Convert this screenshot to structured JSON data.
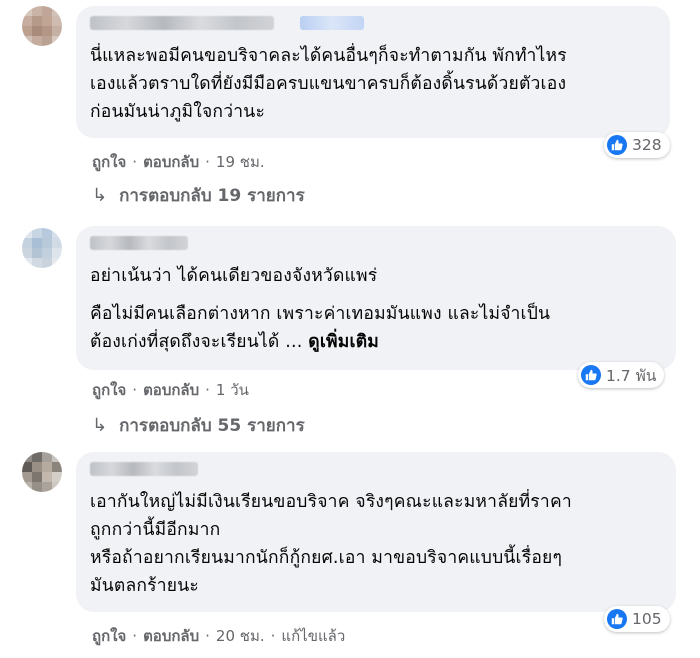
{
  "comments": [
    {
      "text_lines": [
        "นี่แหละพอมีคนขอบริจาคละได้คนอื่นๆก็จะทำตามกัน พักทำไหร",
        "เองแล้วตราบใดที่ยังมีมือครบแขนขาครบก็ต้องดิ้นรนด้วยตัวเอง",
        "ก่อนมันน่าภูมิใจกว่านะ"
      ],
      "reaction_count": "328",
      "like_label": "ถูกใจ",
      "reply_label": "ตอบกลับ",
      "time": "19 ชม.",
      "replies_label": "การตอบกลับ 19 รายการ"
    },
    {
      "paragraph1": "อย่าเน้นว่า ได้คนเดียวของจังหวัดแพร่",
      "paragraph2_line1": "คือไม่มีคนเลือกต่างหาก เพราะค่าเทอมมันแพง และไม่จำเป็น",
      "paragraph2_line2": "ต้องเก่งที่สุดถึงจะเรียนได้ ... ",
      "see_more": "ดูเพิ่มเติม",
      "reaction_count": "1.7 พัน",
      "like_label": "ถูกใจ",
      "reply_label": "ตอบกลับ",
      "time": "1 วัน",
      "replies_label": "การตอบกลับ 55 รายการ"
    },
    {
      "paragraph1_line1": "เอากันใหญ่ไม่มีเงินเรียนขอบริจาค จริงๆคณะและมหาลัยที่ราคา",
      "paragraph1_line2": "ถูกกว่านี้มีอีกมาก",
      "paragraph2_line1": "หรือถ้าอยากเรียนมากนักก็กู้กยศ.เอา มาขอบริจาคแบบนี้เรื่อยๆ",
      "paragraph2_line2": "มันตลกร้ายนะ",
      "reaction_count": "105",
      "like_label": "ถูกใจ",
      "reply_label": "ตอบกลับ",
      "time": "20 ชม.",
      "edited_label": "แก้ไขแล้ว"
    }
  ],
  "colors": {
    "bubble_bg": "#f0f2f5",
    "like_blue": "#1877f2",
    "meta_gray": "#65676b",
    "text": "#050505"
  }
}
